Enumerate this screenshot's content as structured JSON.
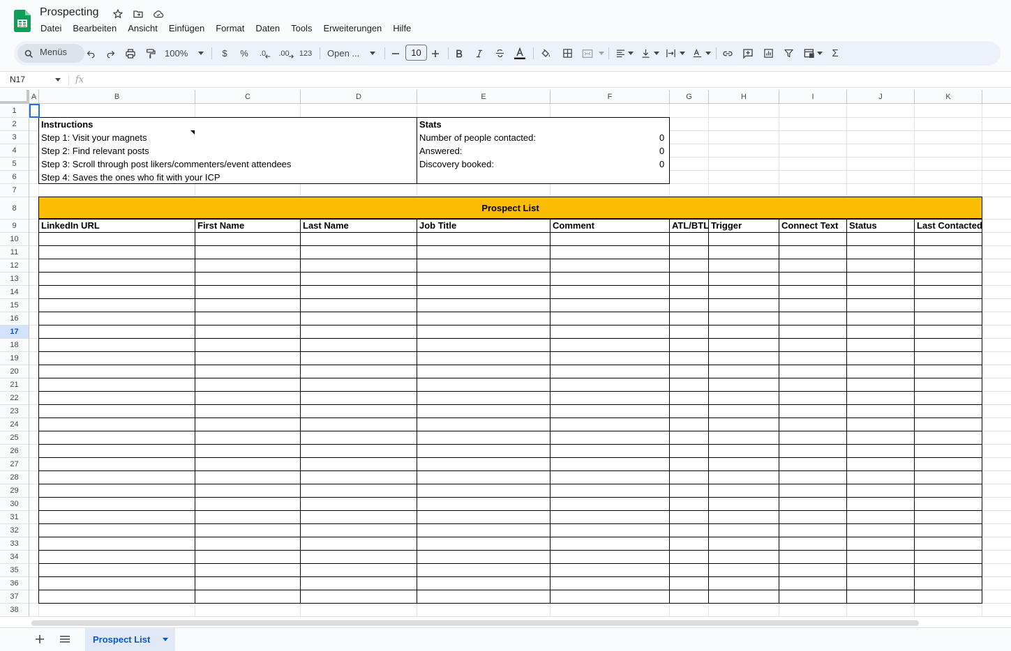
{
  "document": {
    "title": "Prospecting",
    "menus": [
      "Datei",
      "Bearbeiten",
      "Ansicht",
      "Einfügen",
      "Format",
      "Daten",
      "Tools",
      "Erweiterungen",
      "Hilfe"
    ]
  },
  "toolbar": {
    "search_label": "Menüs",
    "zoom": "100%",
    "currency_label": "$",
    "percent_label": "%",
    "decrease_decimal_label": ".0",
    "increase_decimal_label": ".00",
    "number_format_label": "123",
    "font_name": "Open ...",
    "font_size": "10",
    "sum_label": "Σ"
  },
  "formula_bar": {
    "cell_ref": "N17",
    "fx_label": "fx",
    "formula": ""
  },
  "grid": {
    "columns": [
      "A",
      "B",
      "C",
      "D",
      "E",
      "F",
      "G",
      "H",
      "I",
      "J",
      "K"
    ],
    "rows": [
      "1",
      "2",
      "3",
      "4",
      "5",
      "6",
      "7",
      "8",
      "9",
      "10",
      "11",
      "12",
      "13",
      "14",
      "15",
      "16",
      "17",
      "18",
      "19",
      "20",
      "21",
      "22",
      "23",
      "24",
      "25",
      "26",
      "27",
      "28",
      "29",
      "30",
      "31",
      "32",
      "33",
      "34",
      "35",
      "36",
      "37",
      "38"
    ],
    "active_row": "17"
  },
  "instructions": {
    "title": "Instructions",
    "steps": [
      "Step 1: Visit your magnets",
      "Step 2: Find relevant posts",
      "Step 3: Scroll through post likers/commenters/event attendees",
      "Step 4: Saves the ones who fit with your ICP"
    ]
  },
  "stats": {
    "title": "Stats",
    "items": [
      {
        "label": "Number of people contacted:",
        "value": "0"
      },
      {
        "label": "Answered:",
        "value": "0"
      },
      {
        "label": "Discovery booked:",
        "value": "0"
      }
    ]
  },
  "prospect_list": {
    "title": "Prospect List",
    "header_color": "#fbbc04",
    "headers": [
      "LinkedIn URL",
      "First Name",
      "Last Name",
      "Job Title",
      "Comment",
      "ATL/BTL",
      "Trigger",
      "Connect Text",
      "Status",
      "Last Contacted"
    ]
  },
  "sheets": {
    "active": "Prospect List"
  }
}
